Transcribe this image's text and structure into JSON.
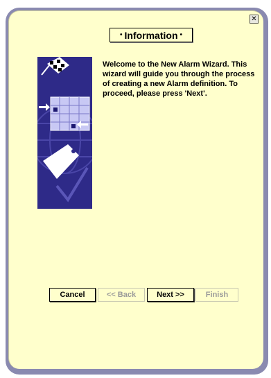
{
  "dialog": {
    "close_glyph": "✕",
    "title": "Information",
    "title_bullet": "•",
    "message": "Welcome to the New Alarm Wizard. This wizard will guide you through the process of creating a new Alarm definition. To proceed, please press 'Next'.",
    "illustration_icon": "alarm-wizard-illustration"
  },
  "buttons": {
    "cancel": "Cancel",
    "back": "<< Back",
    "next": "Next >>",
    "finish": "Finish"
  },
  "colors": {
    "panel_background": "#ffffcc",
    "frame_border": "#8a8ab0",
    "illustration_background": "#2e2a88"
  }
}
